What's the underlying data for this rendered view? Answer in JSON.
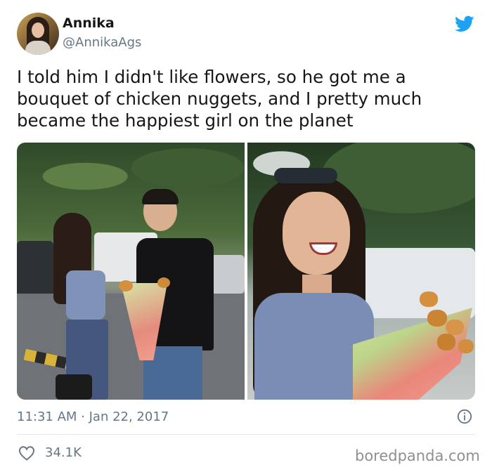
{
  "author": {
    "name": "Annika",
    "handle": "@AnnikaAgs"
  },
  "tweet": {
    "text": "I told him I didn't like flowers, so he got me a bouquet of chicken nuggets, and I pretty much became the happiest girl on the planet",
    "timestamp": "11:31 AM · Jan 22, 2017",
    "likes": "34.1K"
  },
  "icons": {
    "brand": "twitter-bird-icon",
    "info": "info-icon",
    "like": "heart-icon"
  },
  "colors": {
    "brand_blue": "#1da1f2",
    "muted_gray": "#657786",
    "text": "#14171a"
  },
  "watermark": "boredpanda.com"
}
